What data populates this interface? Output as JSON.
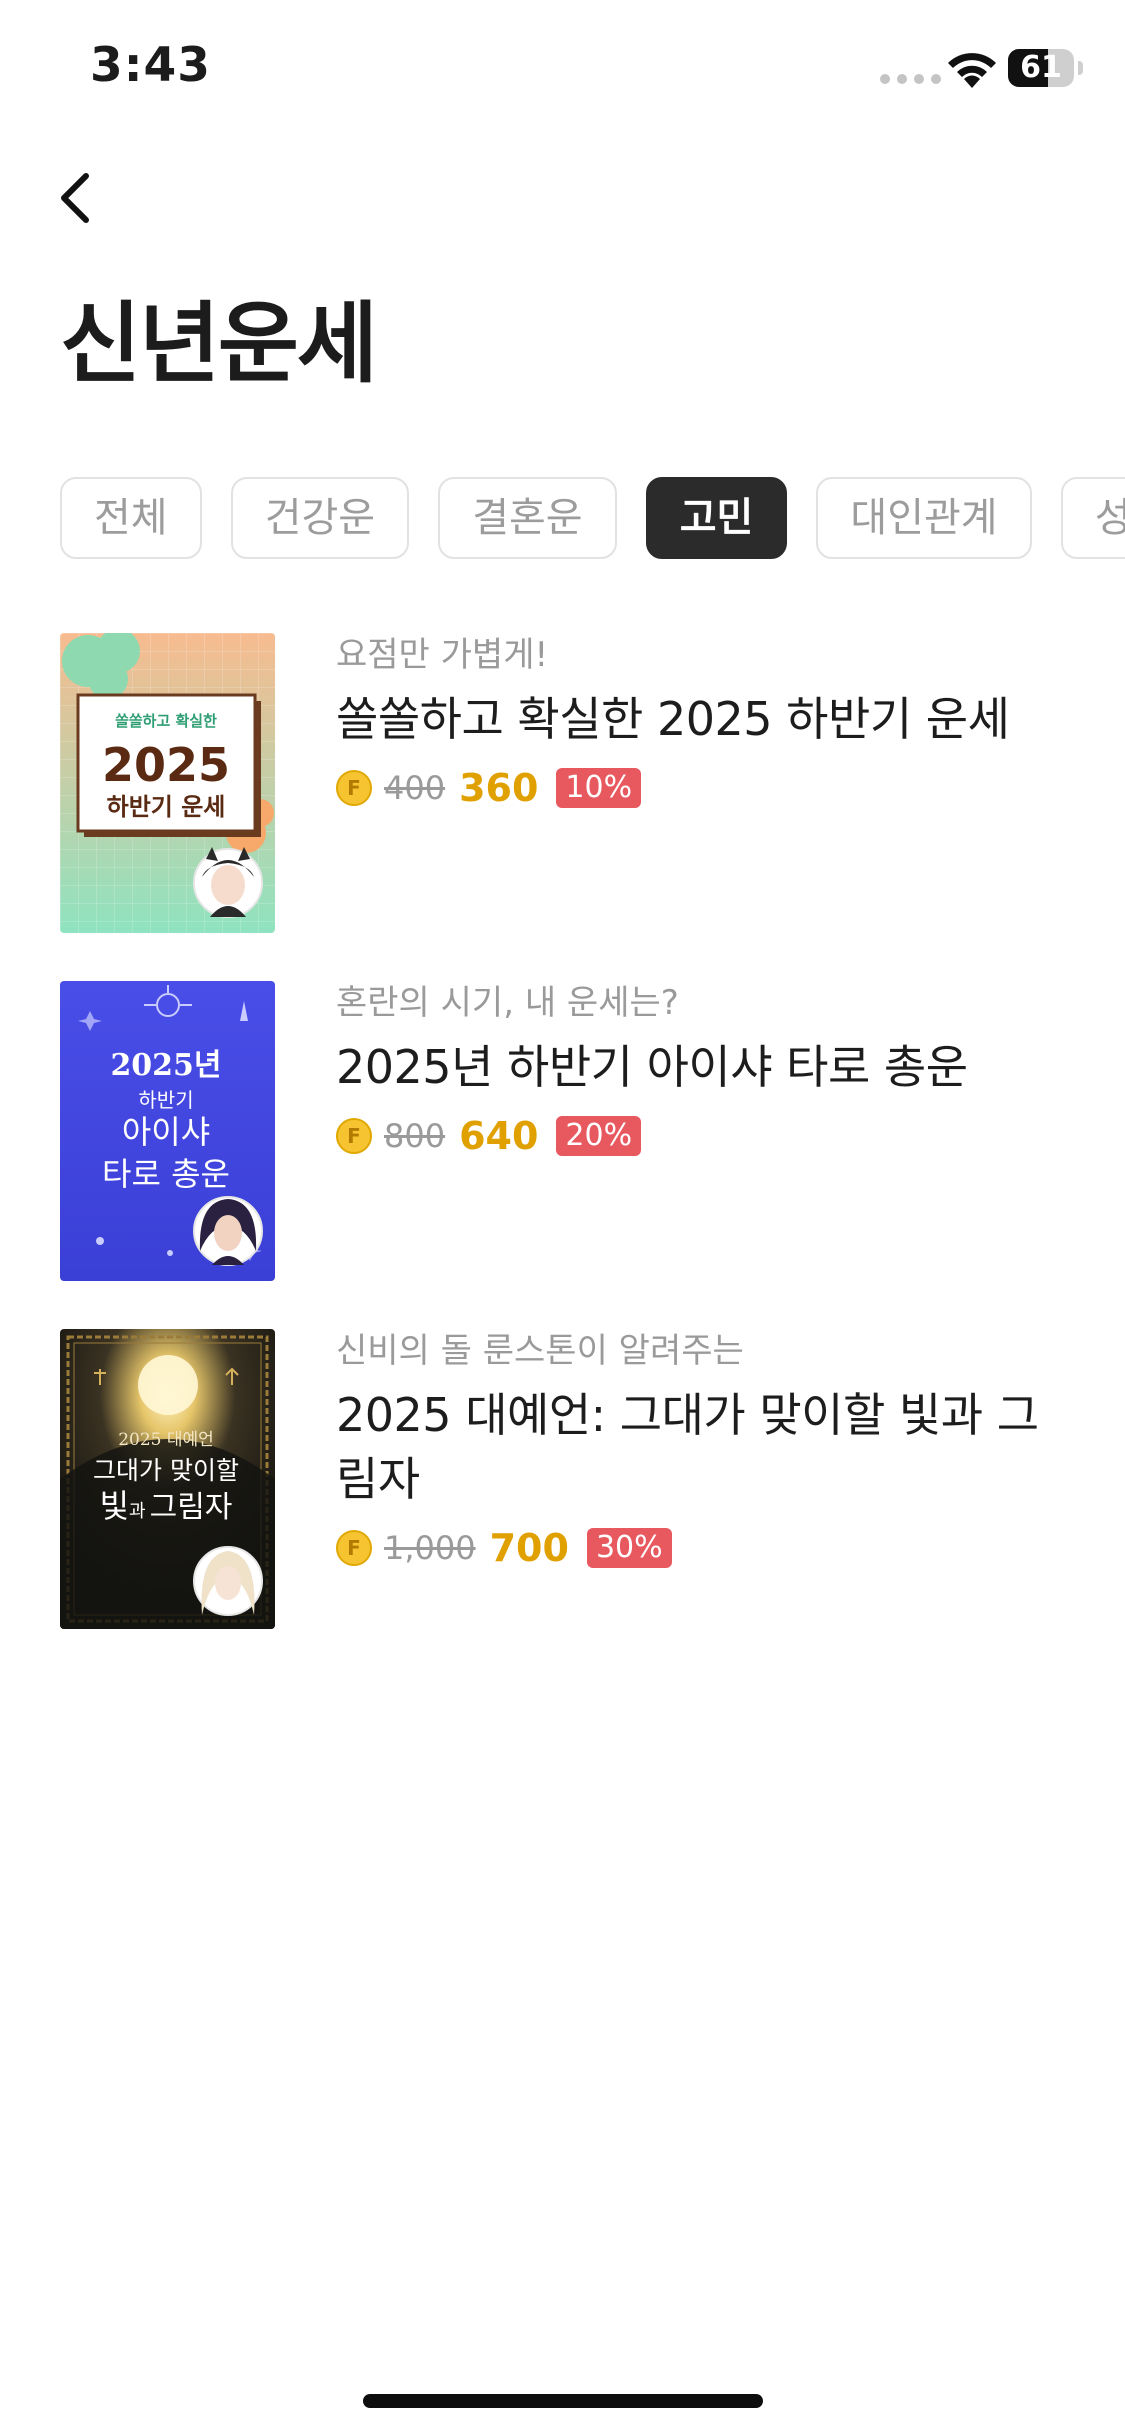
{
  "status_bar": {
    "time": "3:43",
    "battery": "61",
    "battery_level": 0.61
  },
  "header": {
    "title": "신년운세"
  },
  "tabs": [
    {
      "label": "전체",
      "active": false
    },
    {
      "label": "건강운",
      "active": false
    },
    {
      "label": "결혼운",
      "active": false
    },
    {
      "label": "고민",
      "active": true
    },
    {
      "label": "대인관계",
      "active": false
    },
    {
      "label": "성공",
      "active": false
    }
  ],
  "currency_icon": "F",
  "items": [
    {
      "subtitle": "요점만 가볍게!",
      "title": "쏠쏠하고 확실한 2025 하반기 운세",
      "old_price": "400",
      "price": "360",
      "discount": "10%",
      "thumb": {
        "line1": "쏠쏠하고 확실한",
        "line2": "2025",
        "line3": "하반기 운세"
      }
    },
    {
      "subtitle": "혼란의 시기, 내 운세는?",
      "title": "2025년 하반기 아이샤 타로 총운",
      "old_price": "800",
      "price": "640",
      "discount": "20%",
      "thumb": {
        "line1": "2025년",
        "line2": "하반기",
        "line3": "아이샤",
        "line4": "타로 총운"
      }
    },
    {
      "subtitle": "신비의 돌 룬스톤이 알려주는",
      "title": "2025 대예언: 그대가 맞이할 빛과 그림자",
      "old_price": "1,000",
      "price": "700",
      "discount": "30%",
      "thumb": {
        "line1": "2025 대예언",
        "line2": "그대가 맞이할",
        "line3a": "빛",
        "line3b": "과",
        "line3c": "그림자"
      }
    }
  ],
  "colors": {
    "accent_price": "#e0a000",
    "discount_bg": "#e8585f",
    "active_tab_bg": "#2b2b2b"
  }
}
